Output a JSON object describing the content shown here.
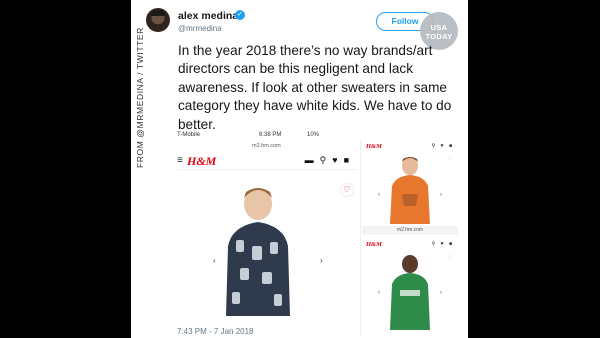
{
  "credit": "FROM @MRMEDINA / TWITTER",
  "tweet": {
    "name": "alex medina",
    "handle": "@mrmedina",
    "follow_label": "Follow",
    "text": "In the year 2018 there’s no way brands/art directors can be this negligent and lack awareness. If look at other sweaters in same category they have white kids. We have to do better.",
    "timestamp": "7:43 PM - 7 Jan 2018"
  },
  "watermark": {
    "line1": "USA",
    "line2": "TODAY"
  },
  "embedded_screenshot": {
    "status_carrier": "T-Mobile",
    "status_time": "6:38 PM",
    "status_battery": "10%",
    "url": "m2.hm.com",
    "brand": "H&M",
    "thumb_url": "m2.hm.com"
  },
  "colors": {
    "twitter_blue": "#1da1f2",
    "hm_red": "#e50010",
    "hoodie_orange": "#e8772e",
    "hoodie_green": "#2e8b4a",
    "hoodie_navy": "#2f3a4d"
  },
  "icons": {
    "verified": "verified-badge-icon",
    "menu": "hamburger-menu-icon",
    "search": "search-icon",
    "favorite": "heart-icon",
    "bag": "shopping-bag-icon",
    "prev": "chevron-left-icon",
    "next": "chevron-right-icon",
    "more": "chevron-down-icon"
  }
}
